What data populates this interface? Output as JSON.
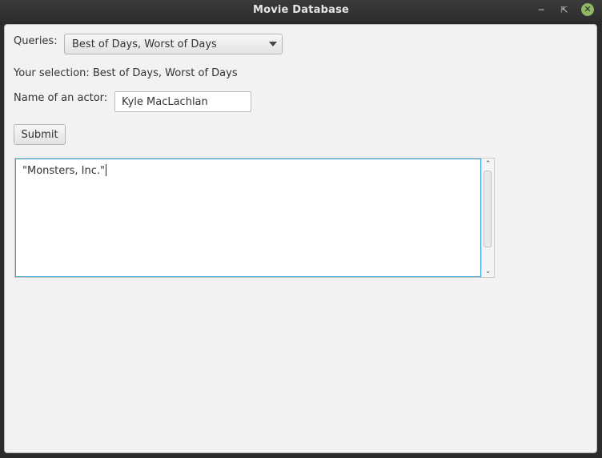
{
  "window": {
    "title": "Movie Database"
  },
  "queries": {
    "label": "Queries:",
    "selected": "Best of Days, Worst of Days"
  },
  "selection": {
    "text": "Your selection: Best of Days, Worst of Days"
  },
  "actor": {
    "label": "Name of an actor:",
    "value": "Kyle MacLachlan"
  },
  "submit": {
    "label": "Submit"
  },
  "results": {
    "text": "\"Monsters, Inc.\""
  }
}
